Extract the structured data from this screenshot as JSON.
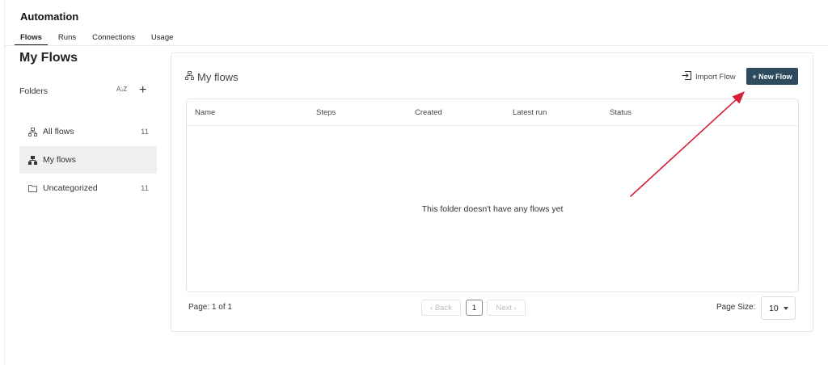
{
  "app": {
    "title": "Automation"
  },
  "tabs": [
    {
      "label": "Flows",
      "active": true
    },
    {
      "label": "Runs",
      "active": false
    },
    {
      "label": "Connections",
      "active": false
    },
    {
      "label": "Usage",
      "active": false
    }
  ],
  "sidebar": {
    "page_title": "My Flows",
    "folders_label": "Folders",
    "sort_icon": "sort-az-icon",
    "sort_glyph": "A↓Z",
    "add_icon": "plus-icon",
    "add_glyph": "+",
    "items": [
      {
        "label": "All flows",
        "count": "11",
        "icon": "flow-tree-icon",
        "selected": false
      },
      {
        "label": "My flows",
        "count": "",
        "icon": "flow-tree-icon",
        "selected": true
      },
      {
        "label": "Uncategorized",
        "count": "11",
        "icon": "folder-icon",
        "selected": false
      }
    ]
  },
  "main": {
    "panel_title": "My flows",
    "import_label": "Import Flow",
    "new_label": "+ New Flow",
    "table": {
      "columns": [
        "Name",
        "Steps",
        "Created",
        "Latest run",
        "Status"
      ],
      "empty_text": "This folder doesn't have any flows yet"
    },
    "pagination": {
      "page_info": "Page: 1 of 1",
      "back_label": "‹ Back",
      "next_label": "Next ›",
      "current_page": "1",
      "page_size_label": "Page Size:",
      "page_size_value": "10"
    }
  },
  "colors": {
    "primary_button": "#2c4b5c",
    "annotation_arrow": "#d61f3a",
    "selected_item_bg": "#efefef"
  }
}
